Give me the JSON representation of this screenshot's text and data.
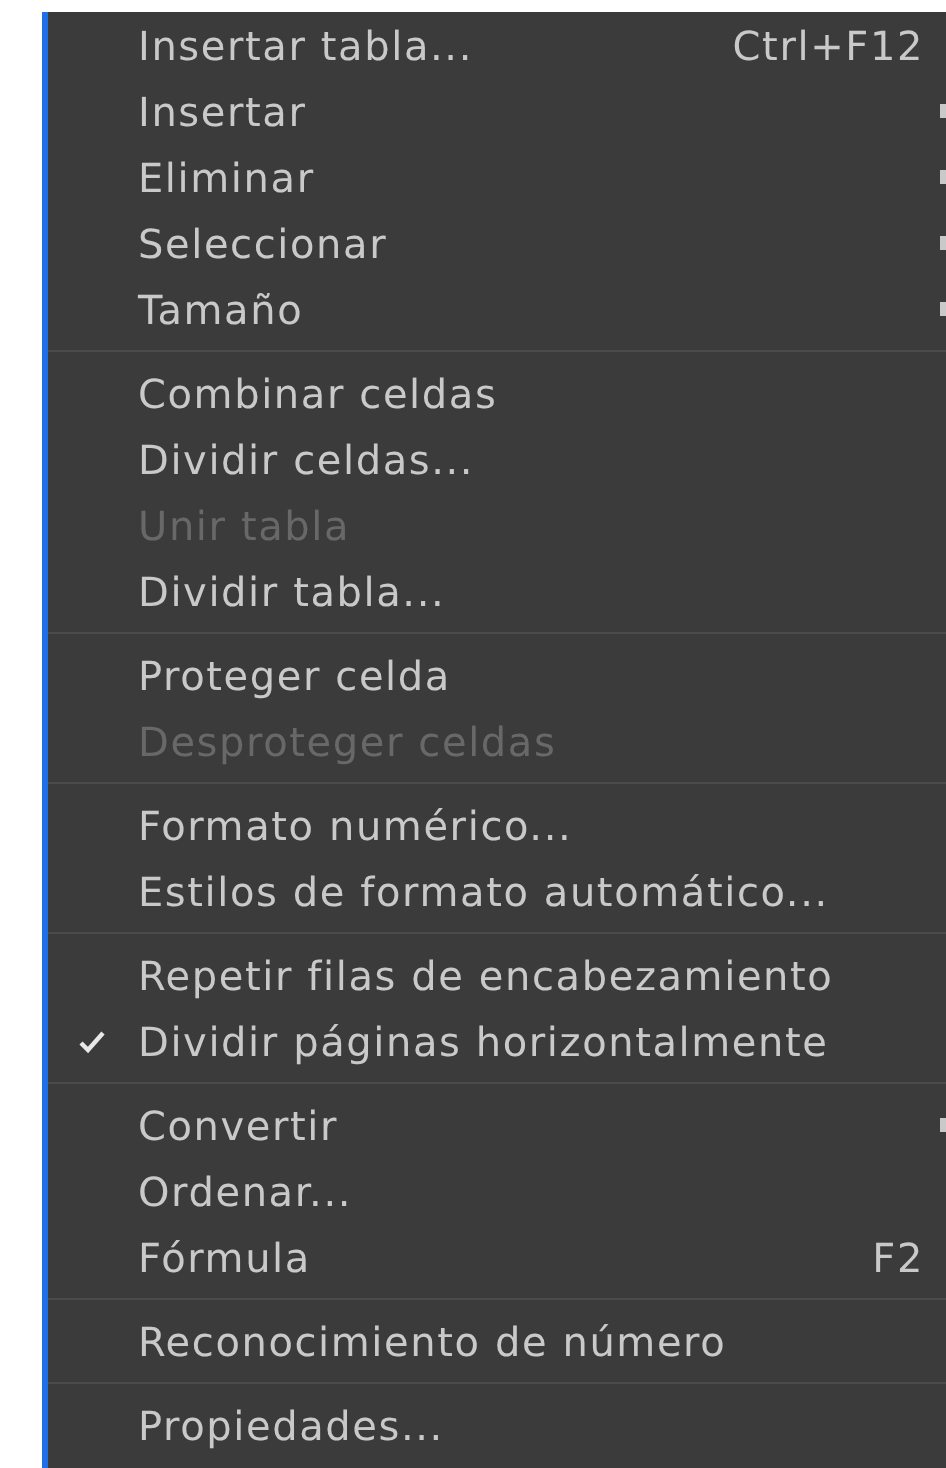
{
  "menu": {
    "groups": [
      {
        "items": [
          {
            "label": "Insertar tabla...",
            "shortcut": "Ctrl+F12",
            "submenu": false,
            "disabled": false,
            "checked": false
          },
          {
            "label": "Insertar",
            "submenu": true,
            "disabled": false,
            "checked": false
          },
          {
            "label": "Eliminar",
            "submenu": true,
            "disabled": false,
            "checked": false
          },
          {
            "label": "Seleccionar",
            "submenu": true,
            "disabled": false,
            "checked": false
          },
          {
            "label": "Tamaño",
            "submenu": true,
            "disabled": false,
            "checked": false
          }
        ]
      },
      {
        "items": [
          {
            "label": "Combinar celdas",
            "submenu": false,
            "disabled": false,
            "checked": false
          },
          {
            "label": "Dividir celdas...",
            "submenu": false,
            "disabled": false,
            "checked": false
          },
          {
            "label": "Unir tabla",
            "submenu": false,
            "disabled": true,
            "checked": false
          },
          {
            "label": "Dividir tabla...",
            "submenu": false,
            "disabled": false,
            "checked": false
          }
        ]
      },
      {
        "items": [
          {
            "label": "Proteger celda",
            "submenu": false,
            "disabled": false,
            "checked": false
          },
          {
            "label": "Desproteger celdas",
            "submenu": false,
            "disabled": true,
            "checked": false
          }
        ]
      },
      {
        "items": [
          {
            "label": "Formato numérico...",
            "submenu": false,
            "disabled": false,
            "checked": false
          },
          {
            "label": "Estilos de formato automático...",
            "submenu": false,
            "disabled": false,
            "checked": false
          }
        ]
      },
      {
        "items": [
          {
            "label": "Repetir filas de encabezamiento",
            "submenu": false,
            "disabled": false,
            "checked": false
          },
          {
            "label": "Dividir páginas horizontalmente",
            "submenu": false,
            "disabled": false,
            "checked": true
          }
        ]
      },
      {
        "items": [
          {
            "label": "Convertir",
            "submenu": true,
            "disabled": false,
            "checked": false
          },
          {
            "label": "Ordenar...",
            "submenu": false,
            "disabled": false,
            "checked": false
          },
          {
            "label": "Fórmula",
            "shortcut": "F2",
            "submenu": false,
            "disabled": false,
            "checked": false
          }
        ]
      },
      {
        "items": [
          {
            "label": "Reconocimiento de número",
            "submenu": false,
            "disabled": false,
            "checked": false
          }
        ]
      },
      {
        "items": [
          {
            "label": "Propiedades...",
            "submenu": false,
            "disabled": false,
            "checked": false
          }
        ]
      }
    ]
  }
}
